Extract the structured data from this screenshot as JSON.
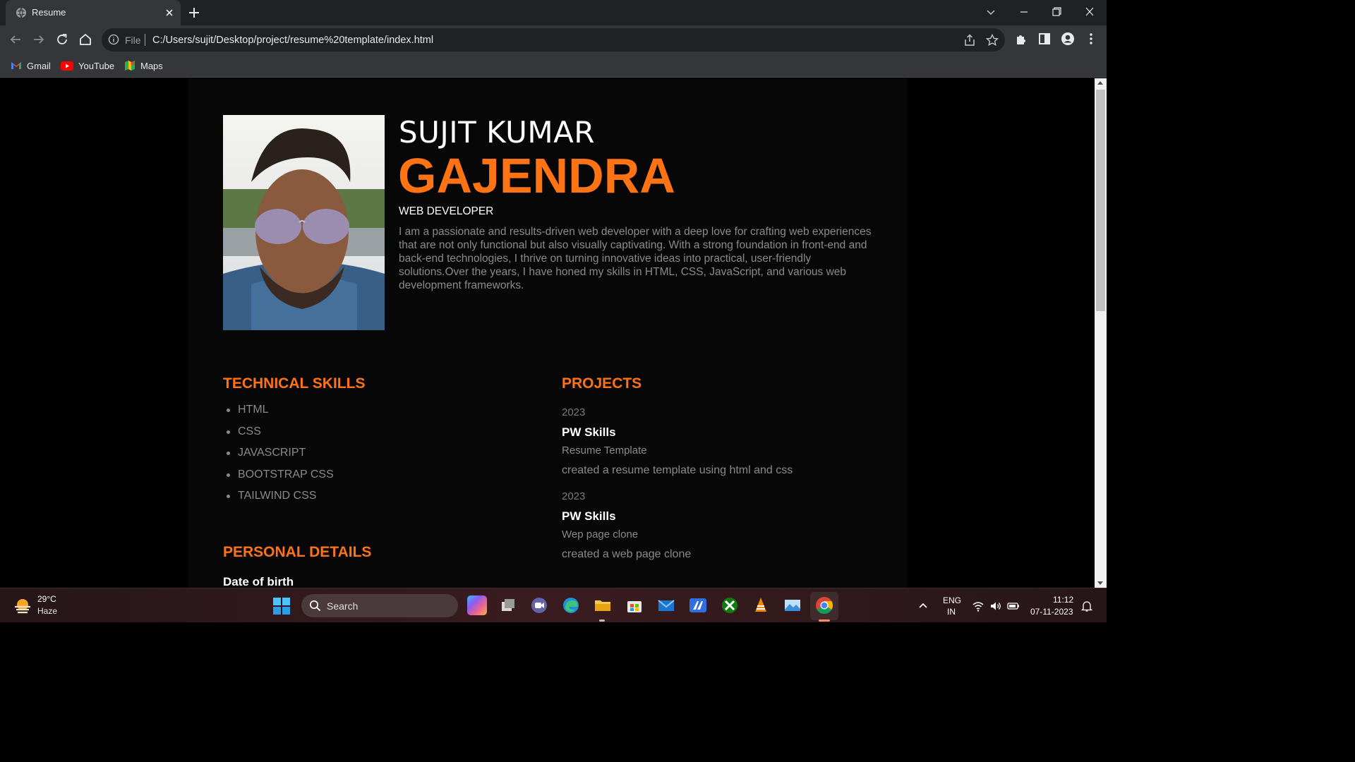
{
  "browser": {
    "tab_title": "Resume",
    "url_scheme": "File",
    "url": "C:/Users/sujit/Desktop/project/resume%20template/index.html",
    "bookmarks": [
      {
        "label": "Gmail",
        "icon": "gmail-icon"
      },
      {
        "label": "YouTube",
        "icon": "youtube-icon"
      },
      {
        "label": "Maps",
        "icon": "maps-icon"
      }
    ]
  },
  "resume": {
    "first_name": "SUJIT KUMAR",
    "last_name": "GAJENDRA",
    "role": "WEB DEVELOPER",
    "bio": "I am a passionate and results-driven web developer with a deep love for crafting web experiences that are not only functional but also visually captivating. With a strong foundation in front-end and back-end technologies, I thrive on turning innovative ideas into practical, user-friendly solutions.Over the years, I have honed my skills in HTML, CSS, JavaScript, and various web development frameworks.",
    "skills_heading": "TECHNICAL SKILLS",
    "skills": [
      "HTML",
      "CSS",
      "JAVASCRIPT",
      "BOOTSTRAP CSS",
      "TAILWIND CSS"
    ],
    "projects_heading": "PROJECTS",
    "projects": [
      {
        "year": "2023",
        "org": "PW Skills",
        "title": "Resume Template",
        "desc": "created a resume template using html and css"
      },
      {
        "year": "2023",
        "org": "PW Skills",
        "title": "Wep page clone",
        "desc": "created a web page clone"
      }
    ],
    "personal_heading": "PERSONAL DETAILS",
    "dob_label": "Date of birth"
  },
  "colors": {
    "accent": "#ff7314",
    "page_bg": "#070707",
    "muted_text": "#8a8a8a"
  },
  "taskbar": {
    "temperature": "29°C",
    "condition": "Haze",
    "search_placeholder": "Search",
    "lang_line1": "ENG",
    "lang_line2": "IN",
    "time": "11:12",
    "date": "07-11-2023",
    "apps": [
      "copilot-icon",
      "task-view-icon",
      "teams-icon",
      "edge-icon",
      "file-explorer-icon",
      "ms-store-icon",
      "mail-icon",
      "sketch-app-icon",
      "xbox-icon",
      "vlc-icon",
      "photos-icon",
      "chrome-icon"
    ]
  }
}
